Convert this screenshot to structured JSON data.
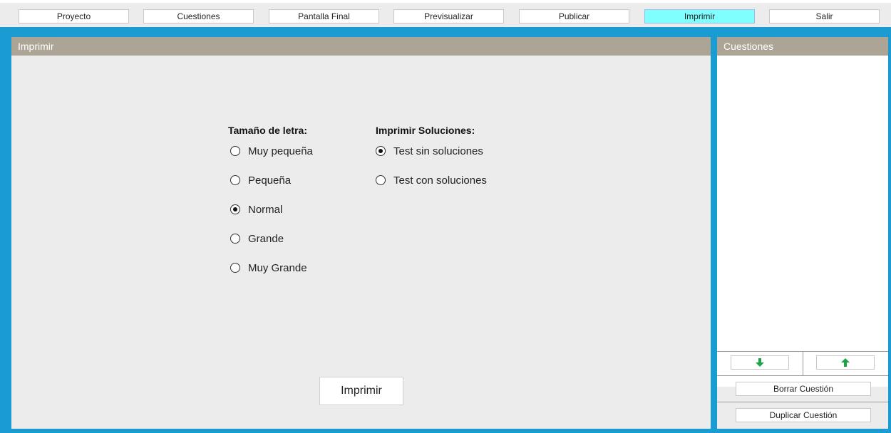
{
  "toolbar": {
    "items": [
      {
        "label": "Proyecto"
      },
      {
        "label": "Cuestiones"
      },
      {
        "label": "Pantalla Final"
      },
      {
        "label": "Previsualizar"
      },
      {
        "label": "Publicar"
      },
      {
        "label": "Imprimir",
        "active": true
      },
      {
        "label": "Salir"
      }
    ],
    "active_color": "#80ffff"
  },
  "colors": {
    "frame": "#1a9bd2",
    "panel_header": "#aca495",
    "panel_bg": "#ececec",
    "arrow_icon": "#1fa34a"
  },
  "left_panel": {
    "title": "Imprimir",
    "font_size_group": {
      "title": "Tamaño de letra:",
      "options": [
        "Muy pequeña",
        "Pequeña",
        "Normal",
        "Grande",
        "Muy Grande"
      ],
      "selected": "Normal"
    },
    "solutions_group": {
      "title": "Imprimir Soluciones:",
      "options": [
        "Test sin soluciones",
        "Test con soluciones"
      ],
      "selected": "Test sin soluciones"
    },
    "print_button": "Imprimir"
  },
  "right_panel": {
    "title": "Cuestiones",
    "move_down_icon": "arrow-down-icon",
    "move_up_icon": "arrow-up-icon",
    "delete_button": "Borrar Cuestión",
    "duplicate_button": "Duplicar Cuestión"
  }
}
